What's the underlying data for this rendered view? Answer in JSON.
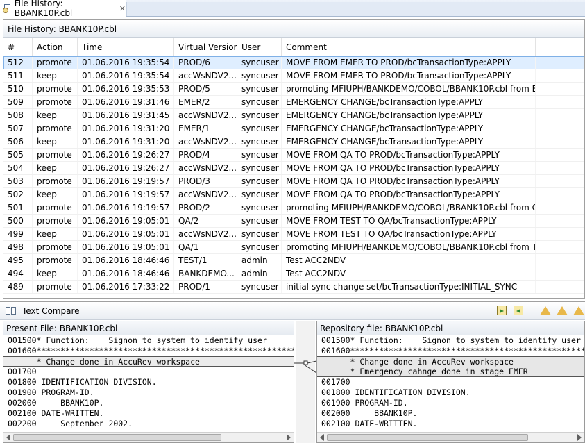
{
  "view_tab": {
    "title": "File History: BBANK10P.cbl",
    "close": "✕"
  },
  "history": {
    "title": "File History: BBANK10P.cbl",
    "columns": [
      "#",
      "Action",
      "Time",
      "Virtual Version",
      "User",
      "Comment"
    ],
    "rows": [
      [
        "512",
        "promote",
        "01.06.2016 19:35:54",
        "PROD/6",
        "syncuser",
        "MOVE FROM EMER TO PROD/bcTransactionType:APPLY"
      ],
      [
        "511",
        "keep",
        "01.06.2016 19:35:54",
        "accWsNDV2...",
        "syncuser",
        "MOVE FROM EMER TO PROD/bcTransactionType:APPLY"
      ],
      [
        "510",
        "promote",
        "01.06.2016 19:35:53",
        "PROD/5",
        "syncuser",
        "promoting MFIUPH/BANKDEMO/COBOL/BBANK10P.cbl from E..."
      ],
      [
        "509",
        "promote",
        "01.06.2016 19:31:46",
        "EMER/2",
        "syncuser",
        "EMERGENCY CHANGE/bcTransactionType:APPLY"
      ],
      [
        "508",
        "keep",
        "01.06.2016 19:31:45",
        "accWsNDV2...",
        "syncuser",
        "EMERGENCY CHANGE/bcTransactionType:APPLY"
      ],
      [
        "507",
        "promote",
        "01.06.2016 19:31:20",
        "EMER/1",
        "syncuser",
        "EMERGENCY CHANGE/bcTransactionType:APPLY"
      ],
      [
        "506",
        "keep",
        "01.06.2016 19:31:20",
        "accWsNDV2...",
        "syncuser",
        "EMERGENCY CHANGE/bcTransactionType:APPLY"
      ],
      [
        "505",
        "promote",
        "01.06.2016 19:26:27",
        "PROD/4",
        "syncuser",
        "MOVE FROM QA TO PROD/bcTransactionType:APPLY"
      ],
      [
        "504",
        "keep",
        "01.06.2016 19:26:27",
        "accWsNDV2...",
        "syncuser",
        "MOVE FROM QA TO PROD/bcTransactionType:APPLY"
      ],
      [
        "503",
        "promote",
        "01.06.2016 19:19:57",
        "PROD/3",
        "syncuser",
        "MOVE FROM QA TO PROD/bcTransactionType:APPLY"
      ],
      [
        "502",
        "keep",
        "01.06.2016 19:19:57",
        "accWsNDV2...",
        "syncuser",
        "MOVE FROM QA TO PROD/bcTransactionType:APPLY"
      ],
      [
        "501",
        "promote",
        "01.06.2016 19:19:57",
        "PROD/2",
        "syncuser",
        "promoting MFIUPH/BANKDEMO/COBOL/BBANK10P.cbl from Q..."
      ],
      [
        "500",
        "promote",
        "01.06.2016 19:05:01",
        "QA/2",
        "syncuser",
        "MOVE FROM TEST TO QA/bcTransactionType:APPLY"
      ],
      [
        "499",
        "keep",
        "01.06.2016 19:05:01",
        "accWsNDV2...",
        "syncuser",
        "MOVE FROM TEST TO QA/bcTransactionType:APPLY"
      ],
      [
        "498",
        "promote",
        "01.06.2016 19:05:01",
        "QA/1",
        "syncuser",
        "promoting MFIUPH/BANKDEMO/COBOL/BBANK10P.cbl from TE..."
      ],
      [
        "495",
        "promote",
        "01.06.2016 18:46:46",
        "TEST/1",
        "admin",
        "Test ACC2NDV"
      ],
      [
        "494",
        "keep",
        "01.06.2016 18:46:46",
        "BANKDEMO...",
        "admin",
        "Test ACC2NDV"
      ],
      [
        "489",
        "promote",
        "01.06.2016 17:33:22",
        "PROD/1",
        "syncuser",
        "initial sync change set/bcTransactionType:INITIAL_SYNC"
      ]
    ],
    "selected_row": "512"
  },
  "compare": {
    "title": "Text Compare",
    "left": {
      "title": "Present File: BBANK10P.cbl",
      "lines": [
        "001500* Function:    Signon to system to identify user",
        "001600*****************************************************************",
        "      * Change done in AccuRev workspace",
        "001700",
        "001800 IDENTIFICATION DIVISION.",
        "001900 PROGRAM-ID.",
        "002000     BBANK10P.",
        "002100 DATE-WRITTEN.",
        "002200     September 2002."
      ]
    },
    "right": {
      "title": "Repository file: BBANK10P.cbl",
      "lines": [
        "001500* Function:    Signon to system to identify user",
        "001600*****************************************************************",
        "      * Change done in AccuRev workspace",
        "      * Emergency cahnge done in stage EMER",
        "001700",
        "001800 IDENTIFICATION DIVISION.",
        "001900 PROGRAM-ID.",
        "002000     BBANK10P.",
        "002100 DATE-WRITTEN."
      ]
    }
  }
}
